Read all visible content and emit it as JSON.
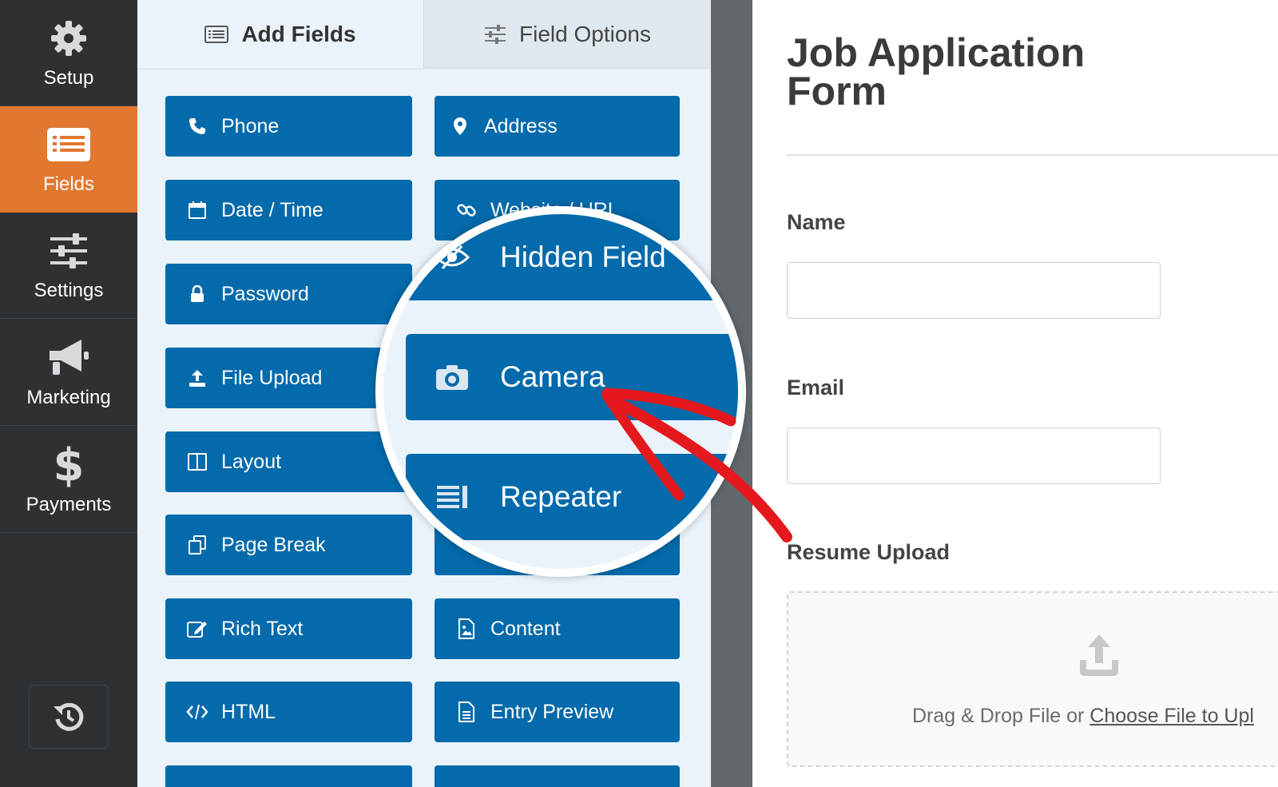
{
  "nav": {
    "setup": "Setup",
    "fields": "Fields",
    "settings": "Settings",
    "marketing": "Marketing",
    "payments": "Payments"
  },
  "tabs": {
    "add_fields": "Add Fields",
    "field_options": "Field Options"
  },
  "fields_left": [
    "Phone",
    "Date / Time",
    "Password",
    "File Upload",
    "Layout",
    "Page Break",
    "Rich Text",
    "HTML"
  ],
  "fields_right": [
    "Address",
    "Website / URL",
    "Content",
    "Entry Preview"
  ],
  "magnifier": [
    "Hidden Field",
    "Camera",
    "Repeater"
  ],
  "form": {
    "title": "Job Application Form",
    "name_label": "Name",
    "email_label": "Email",
    "resume_label": "Resume Upload",
    "dropzone_text": "Drag & Drop File or ",
    "dropzone_link": "Choose File to Upl"
  },
  "colors": {
    "nav_bg": "#2d3134",
    "nav_active": "#e27730",
    "field_button": "#036aab",
    "panel_bg": "#eaf3fa",
    "annotation_arrow": "#e5191d"
  }
}
